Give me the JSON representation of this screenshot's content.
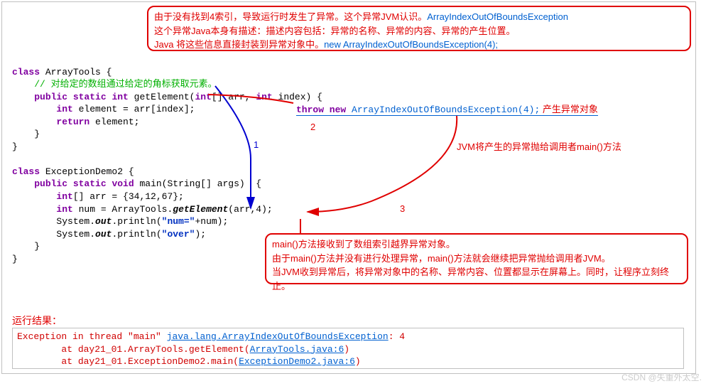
{
  "topNote": {
    "l1a": "由于没有找到4索引，导致运行时发生了异常。这个异常JVM认识。",
    "l1b": "ArrayIndexOutOfBoundsException",
    "l2": "这个异常Java本身有描述：描述内容包括：异常的名称、异常的内容、异常的产生位置。",
    "l3a": "Java 将这些信息直接封装到异常对象中。",
    "l3b": "new ArrayIndexOutOfBoundsException(4);"
  },
  "code": {
    "c1": {
      "kw": "class",
      "name": " ArrayTools {"
    },
    "comment": "    // 对给定的数组通过给定的角标获取元素。",
    "c2": {
      "a": "    ",
      "kw1": "public static",
      "b": " ",
      "kw2": "int",
      "c": " getElement(",
      "kw3": "int",
      "d": "[] arr, ",
      "kw4": "int",
      "e": " index) {"
    },
    "c3": {
      "a": "        ",
      "kw": "int",
      "b": " element = arr[index];"
    },
    "c4": {
      "a": "        ",
      "kw": "return",
      "b": " element;"
    },
    "c5": "    }",
    "c6": "}",
    "blank": "",
    "c7": {
      "kw": "class",
      "name": " ExceptionDemo2 {"
    },
    "c8": {
      "a": "    ",
      "kw1": "public static",
      "b": " ",
      "kw2": "void",
      "c": " main(String[] args)  {"
    },
    "c9": {
      "a": "        ",
      "kw": "int",
      "b": "[] arr = {34,12,67};"
    },
    "c10": {
      "a": "        ",
      "kw": "int",
      "b": " num = ArrayTools.",
      "it": "getElement",
      "c": "(arr,4);"
    },
    "c11": {
      "a": "        System.",
      "it": "out",
      "b": ".println(",
      "s": "\"num=\"",
      "c": "+num);"
    },
    "c12": {
      "a": "        System.",
      "it": "out",
      "b": ".println(",
      "s": "\"over\"",
      "c": ");"
    },
    "c13": "    }",
    "c14": "}"
  },
  "throwLine": {
    "a": "throw new ",
    "b": "ArrayIndexOutOfBoundsException(4);",
    "c": " 产生异常对象"
  },
  "labels": {
    "n1": "1",
    "n2": "2",
    "n3": "3",
    "jvm": "JVM将产生的异常抛给调用者main()方法"
  },
  "midNote": {
    "l1": "main()方法接收到了数组索引越界异常对象。",
    "l2": "由于main()方法并没有进行处理异常，main()方法就会继续把异常抛给调用者JVM。",
    "l3": "当JVM收到异常后，将异常对象中的名称、异常内容、位置都显示在屏幕上。同时，让程序立刻终止。"
  },
  "resultLabel": "运行结果：",
  "result": {
    "r1a": "Exception in thread \"main\" ",
    "r1b": "java.lang.ArrayIndexOutOfBoundsException",
    "r1c": ": 4",
    "r2a": "        at day21_01.ArrayTools.getElement(",
    "r2b": "ArrayTools.java:6",
    "r2c": ")",
    "r3a": "        at day21_01.ExceptionDemo2.main(",
    "r3b": "ExceptionDemo2.java:6",
    "r3c": ")"
  },
  "watermark": "CSDN @失重外太空."
}
